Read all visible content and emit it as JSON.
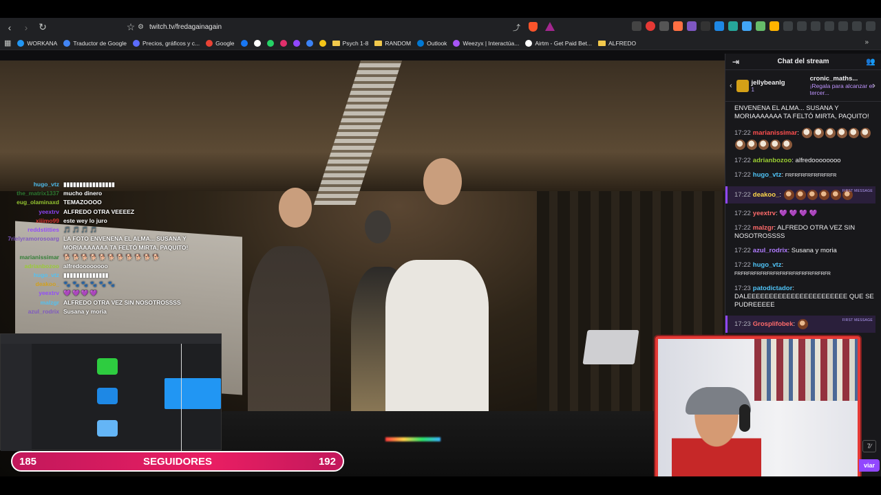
{
  "browser": {
    "url": "twitch.tv/fredagainagain"
  },
  "bookmarks": [
    {
      "label": "WORKANA",
      "color": "#2196f3",
      "kind": "site"
    },
    {
      "label": "Traductor de Google",
      "color": "#4285f4",
      "kind": "site"
    },
    {
      "label": "Precios, gráficos y c...",
      "color": "#5b6cff",
      "kind": "site"
    },
    {
      "label": "Google",
      "color": "#ea4335",
      "kind": "site"
    },
    {
      "label": "",
      "color": "#1877f2",
      "kind": "icon"
    },
    {
      "label": "",
      "color": "#ffffff",
      "kind": "icon"
    },
    {
      "label": "",
      "color": "#25d366",
      "kind": "icon"
    },
    {
      "label": "",
      "color": "#e1306c",
      "kind": "icon"
    },
    {
      "label": "",
      "color": "#9147ff",
      "kind": "icon"
    },
    {
      "label": "",
      "color": "#3b82f6",
      "kind": "icon"
    },
    {
      "label": "",
      "color": "#f5c518",
      "kind": "icon"
    },
    {
      "label": "Psych 1-8",
      "color": "#f2c94c",
      "kind": "folder"
    },
    {
      "label": "RANDOM",
      "color": "#f2c94c",
      "kind": "folder"
    },
    {
      "label": "Outlook",
      "color": "#0078d4",
      "kind": "site"
    },
    {
      "label": "Weezyx | Interactúa...",
      "color": "#a855f7",
      "kind": "site"
    },
    {
      "label": "Airtm - Get Paid Bet...",
      "color": "#ffffff",
      "kind": "site"
    },
    {
      "label": "ALFREDO",
      "color": "#f2c94c",
      "kind": "folder"
    }
  ],
  "overlay_chat": [
    {
      "name": "hugo_vtz",
      "msg": "▮▮▮▮▮▮▮▮▮▮▮▮▮▮▮▮"
    },
    {
      "name": "the_matrix1337",
      "msg": "mucho dinero"
    },
    {
      "name": "eug_olaminaxd",
      "msg": "TEMAZOOOO"
    },
    {
      "name": "yeextrv",
      "msg": "ALFREDO OTRA VEEEEZ"
    },
    {
      "name": "xiiimo99",
      "msg": "este wey lo juro"
    },
    {
      "name": "reddstitties",
      "msg": "🎵 🎵 🎵 🎵"
    },
    {
      "name": "7rielyramorosoarg",
      "msg": "LA FOTO ENVENENA EL ALMA... SUSANA Y"
    },
    {
      "name": "",
      "msg": "MORIAAAAAAA TA FELTÓ MIRTA, PAQUITO!"
    },
    {
      "name": "marianissimar",
      "msg": "🐕 🐕 🐕 🐕 🐕 🐕 🐕 🐕 🐕 🐕 🐕"
    },
    {
      "name": "adrianbozoo",
      "msg": "alfredoooooooo"
    },
    {
      "name": "hugo_vtz",
      "msg": "▮▮▮▮▮▮▮▮▮▮▮▮▮▮"
    },
    {
      "name": "deakoo_",
      "msg": "🐾 🐾 🐾 🐾 🐾 🐾"
    },
    {
      "name": "yeextrv",
      "msg": "💜 💜 💜 💜"
    },
    {
      "name": "malzgr",
      "msg": "ALFREDO OTRA VEZ SIN NOSOTROSSSS"
    },
    {
      "name": "azul_rodrix",
      "msg": "Susana y moria"
    }
  ],
  "followers": {
    "current": "185",
    "label": "SEGUIDORES",
    "goal": "192"
  },
  "chat": {
    "title": "Chat del stream",
    "gift": {
      "user1": "jellybeanlg",
      "count1": "1",
      "user2": "cronic_maths...",
      "count2": "1",
      "cta": "¡Regala para alcanzar el tercer..."
    },
    "messages": [
      {
        "time": "",
        "user": "",
        "color": "#efeff1",
        "text": "ENVENENA EL ALMA... SUSANA Y MORIAAAAAAA TA FELTÓ MIRTA, PAQUITO!",
        "emotes": 0,
        "hl": false
      },
      {
        "time": "17:22",
        "user": "marianissimar",
        "color": "#ff4f4f",
        "text": "",
        "emotes": 11,
        "hl": false
      },
      {
        "time": "17:22",
        "user": "adrianbozoo",
        "color": "#9acd32",
        "text": "alfredoooooooo",
        "emotes": 0,
        "hl": false
      },
      {
        "time": "17:22",
        "user": "hugo_vtz",
        "color": "#4fc3f7",
        "text": "FRFRFRFRFRFRFRFR",
        "emotes": 0,
        "hl": false
      },
      {
        "time": "17:22",
        "user": "deakoo_",
        "color": "#ffd84a",
        "text": "",
        "emotes": 6,
        "hl": true
      },
      {
        "time": "17:22",
        "user": "yeextrv",
        "color": "#ff6b6b",
        "text": "💜 💜 💜 💜",
        "emotes": 0,
        "hl": false
      },
      {
        "time": "17:22",
        "user": "malzgr",
        "color": "#ff6b6b",
        "text": "ALFREDO OTRA VEZ SIN NOSOTROSSSS",
        "emotes": 0,
        "hl": false
      },
      {
        "time": "17:22",
        "user": "azul_rodrix",
        "color": "#b07cff",
        "text": "Susana y moria",
        "emotes": 0,
        "hl": false
      },
      {
        "time": "17:22",
        "user": "hugo_vtz",
        "color": "#4fc3f7",
        "text": "FRFRFRFRFRFRFRFRFRFRFRFRFRFRFR",
        "emotes": 0,
        "hl": false
      },
      {
        "time": "17:23",
        "user": "patodictador",
        "color": "#4fc3f7",
        "text": "DALEEEEEEEEEEEEEEEEEEEEEEE QUE SE PUDREEEEE",
        "emotes": 0,
        "hl": false
      },
      {
        "time": "17:23",
        "user": "Grosplifobek",
        "color": "#ff6b6b",
        "text": "",
        "emotes": 1,
        "hl": true
      }
    ],
    "first_message_label": "FIRST MESSAGE",
    "send_label": "viar"
  }
}
